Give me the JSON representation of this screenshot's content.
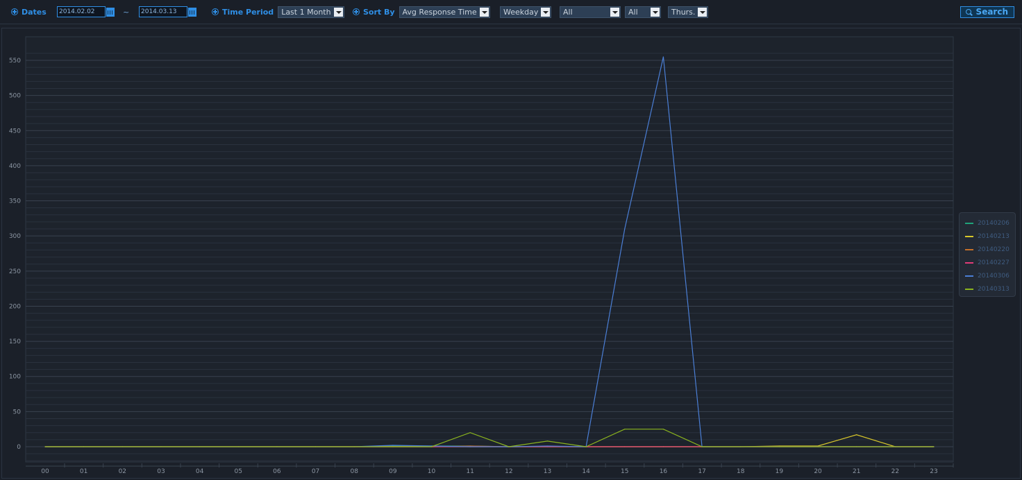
{
  "toolbar": {
    "dates_label": "Dates",
    "start_date": "2014.02.02",
    "date_separator": "~",
    "end_date": "2014.03.13",
    "time_period_label": "Time Period",
    "time_period_value": "Last 1 Month",
    "sort_by_label": "Sort By",
    "sort_by_value": "Avg Response Time",
    "day_type_value": "Weekday",
    "filter1_value": "All",
    "filter2_value": "All",
    "day_value": "Thurs.",
    "search_label": "Search"
  },
  "colors": {
    "accent": "#2f8fe6",
    "background": "#1b2029",
    "grid": "#2a323e"
  },
  "chart_data": {
    "type": "line",
    "categories": [
      "00",
      "01",
      "02",
      "03",
      "04",
      "05",
      "06",
      "07",
      "08",
      "09",
      "10",
      "11",
      "12",
      "13",
      "14",
      "15",
      "16",
      "17",
      "18",
      "19",
      "20",
      "21",
      "22",
      "23"
    ],
    "ylim": [
      0,
      570
    ],
    "yticks": [
      0,
      50,
      100,
      150,
      200,
      250,
      300,
      350,
      400,
      450,
      500,
      550
    ],
    "legend_position": "right",
    "grid": true,
    "series": [
      {
        "name": "20140206",
        "color": "#1fa37a",
        "values": [
          0,
          0,
          0,
          0,
          0,
          0,
          0,
          0,
          0,
          1,
          1,
          1,
          0,
          0,
          0,
          0,
          0,
          0,
          0,
          0,
          0,
          0,
          0,
          0
        ]
      },
      {
        "name": "20140213",
        "color": "#d8c72a",
        "values": [
          0,
          0,
          0,
          0,
          0,
          0,
          0,
          0,
          0,
          0,
          0,
          0,
          0,
          0,
          0,
          0,
          0,
          0,
          0,
          1,
          1,
          17,
          0,
          0
        ]
      },
      {
        "name": "20140220",
        "color": "#c5702a",
        "values": [
          0,
          0,
          0,
          0,
          0,
          0,
          0,
          0,
          0,
          0,
          0,
          1,
          0,
          0,
          0,
          0,
          0,
          0,
          0,
          0,
          0,
          0,
          0,
          0
        ]
      },
      {
        "name": "20140227",
        "color": "#e23c78",
        "values": [
          0,
          0,
          0,
          0,
          0,
          0,
          0,
          0,
          0,
          0,
          0,
          0,
          0,
          0,
          0,
          0,
          0,
          0,
          0,
          0,
          0,
          0,
          0,
          0
        ]
      },
      {
        "name": "20140306",
        "color": "#4b7fd6",
        "values": [
          0,
          0,
          0,
          0,
          0,
          0,
          0,
          0,
          0,
          2,
          1,
          0,
          0,
          1,
          0,
          310,
          555,
          0,
          0,
          0,
          0,
          0,
          0,
          0
        ]
      },
      {
        "name": "20140313",
        "color": "#8cb51e",
        "values": [
          0,
          0,
          0,
          0,
          0,
          0,
          0,
          0,
          0,
          0,
          0,
          20,
          0,
          8,
          0,
          25,
          25,
          0,
          0,
          0,
          0,
          0,
          0,
          0
        ]
      }
    ]
  }
}
